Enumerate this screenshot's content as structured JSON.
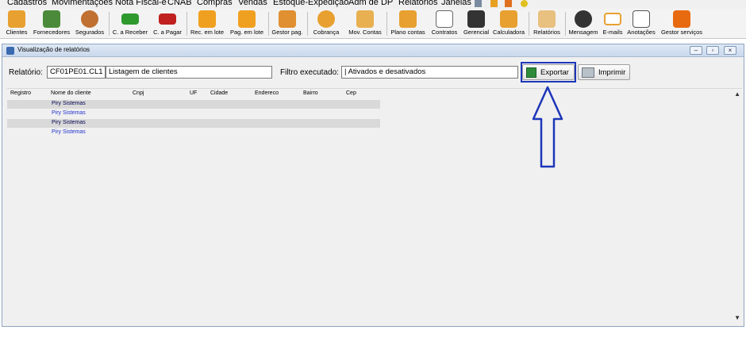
{
  "menu": {
    "items": [
      "Cadastros",
      "Movimentações",
      "Nota Fiscal-e",
      "CNAB",
      "Compras",
      "Vendas",
      "Estoque-Expedição",
      "Adm de DP",
      "Relatórios",
      "Janelas"
    ]
  },
  "toolbar": {
    "buttons": [
      {
        "label": "Clientes",
        "icon": "clientes-icon",
        "color": "#e8a030"
      },
      {
        "label": "Fornecedores",
        "icon": "fornecedores-icon",
        "color": "#4a8a3a"
      },
      {
        "label": "Segurados",
        "icon": "segurados-icon",
        "color": "#c07030"
      },
      {
        "label": "C. a Receber",
        "icon": "money-green-icon",
        "color": "#2e9a2e"
      },
      {
        "label": "C. a Pagar",
        "icon": "money-red-icon",
        "color": "#c02020"
      },
      {
        "label": "Rec. em lote",
        "icon": "dollar-icon",
        "color": "#f0a020"
      },
      {
        "label": "Pag. em lote",
        "icon": "dollar-icon",
        "color": "#f0a020"
      },
      {
        "label": "Gestor pag.",
        "icon": "gestor-pag-icon",
        "color": "#e09030"
      },
      {
        "label": "Cobrança",
        "icon": "phone-icon",
        "color": "#e8a030"
      },
      {
        "label": "Mov. Contas",
        "icon": "boxes-icon",
        "color": "#e8b050"
      },
      {
        "label": "Plano contas",
        "icon": "plano-contas-icon",
        "color": "#e8a030"
      },
      {
        "label": "Contratos",
        "icon": "document-icon",
        "color": "#666666"
      },
      {
        "label": "Gerencial",
        "icon": "chart-up-icon",
        "color": "#333333"
      },
      {
        "label": "Calculadora",
        "icon": "calculator-icon",
        "color": "#e8a030"
      },
      {
        "label": "Relatórios",
        "icon": "folder-icon",
        "color": "#e8c080"
      },
      {
        "label": "Mensagem",
        "icon": "chat-icon",
        "color": "#333333"
      },
      {
        "label": "E-mails",
        "icon": "envelope-icon",
        "color": "#e8a030"
      },
      {
        "label": "Anotações",
        "icon": "notepad-icon",
        "color": "#555555"
      },
      {
        "label": "Gestor serviços",
        "icon": "gears-icon",
        "color": "#e86a10"
      }
    ]
  },
  "window": {
    "title": "Visualização de relatórios",
    "report_label": "Relatório:",
    "report_code": "CF01PE01.CL1",
    "report_name": "Listagem de clientes",
    "filter_label": "Filtro executado:",
    "filter_value": "| Ativados e desativados",
    "export_label": "Exportar",
    "print_label": "Imprimir"
  },
  "grid": {
    "columns": [
      "Registro",
      "Nome do cliente",
      "Cnpj",
      "UF",
      "Cidade",
      "Endereco",
      "Bairro",
      "Cep"
    ],
    "rows": [
      {
        "nome": "Piry Sistemas"
      },
      {
        "nome": "Piry Sistemas"
      },
      {
        "nome": "Piry Sistemas"
      },
      {
        "nome": "Piry Sistemas"
      }
    ]
  },
  "colors": {
    "highlight_border": "#1d36b8",
    "arrow": "#1d36b8",
    "row_text_odd": "#000050",
    "row_text_even": "#2233cc"
  }
}
